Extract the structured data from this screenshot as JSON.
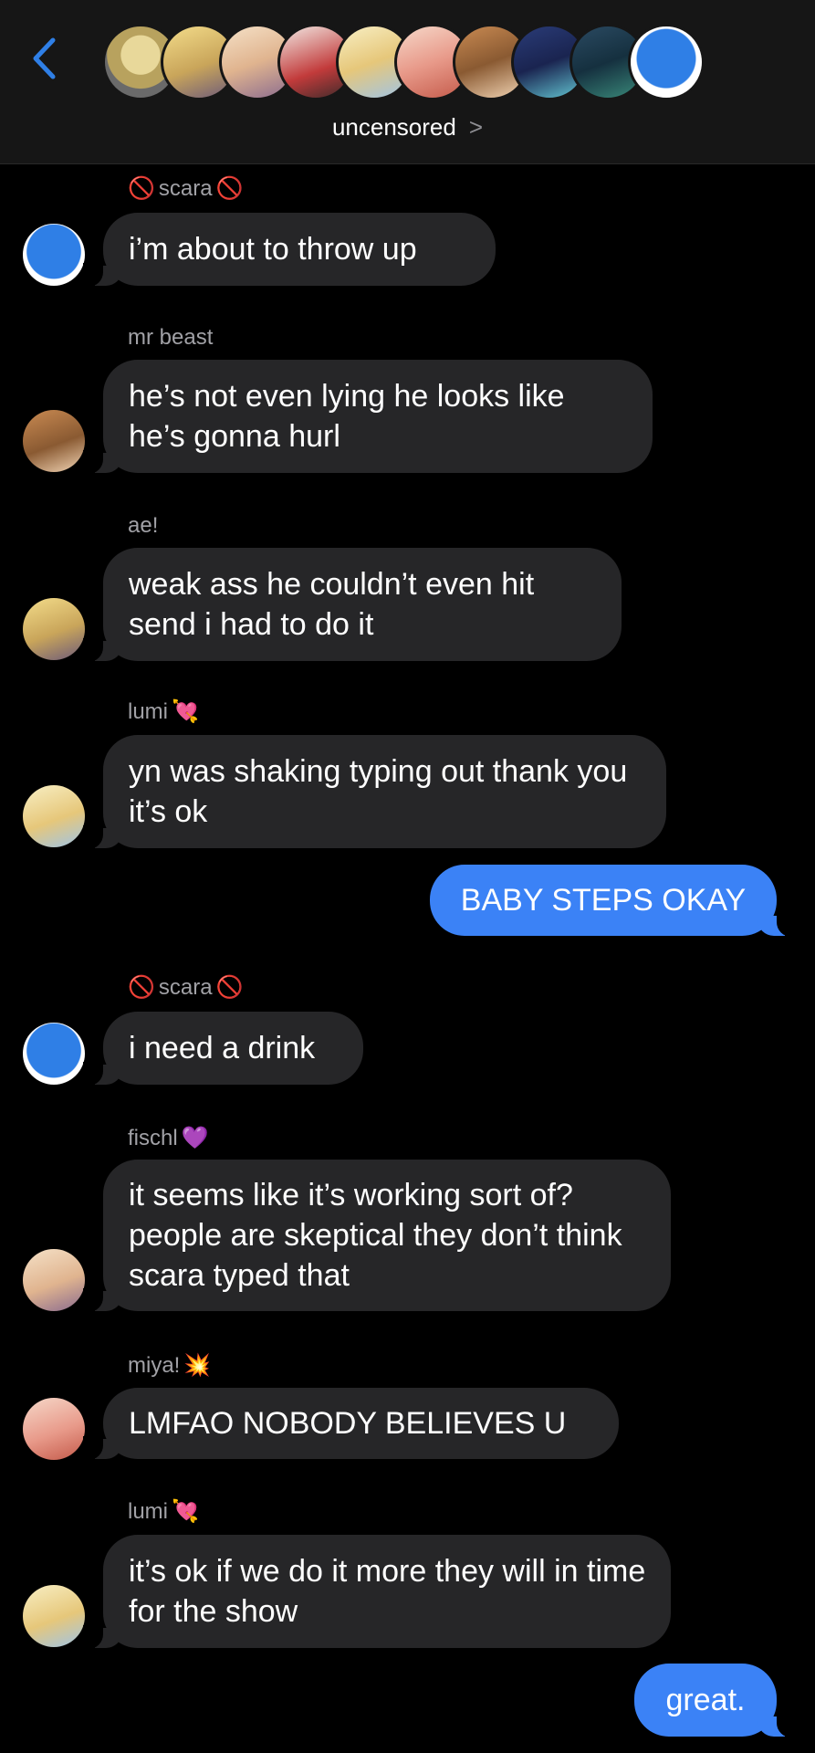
{
  "header": {
    "title": "uncensored",
    "chevron": ">",
    "back_icon": "chevron-left-icon",
    "accent": "#2f7fe6",
    "group_avatars": 11
  },
  "messages": [
    {
      "sender": "scara",
      "sender_prefix_icon": "prohibited-icon",
      "sender_suffix_icon": "prohibited-icon",
      "text": "i’m about to throw up",
      "side": "left"
    },
    {
      "sender": "mr beast",
      "text": "he’s not even lying he looks like he’s gonna hurl",
      "side": "left"
    },
    {
      "sender": "ae!",
      "text": "weak ass he couldn’t even hit send i had to do it",
      "side": "left"
    },
    {
      "sender": "lumi",
      "sender_suffix_icon": "heart-with-arrow-icon",
      "text": "yn was shaking typing out thank you it’s ok",
      "side": "left"
    },
    {
      "text": "BABY STEPS OKAY",
      "side": "right"
    },
    {
      "sender": "scara",
      "sender_prefix_icon": "prohibited-icon",
      "sender_suffix_icon": "prohibited-icon",
      "text": "i need a drink",
      "side": "left"
    },
    {
      "sender": "fischl",
      "sender_suffix_icon": "purple-heart-icon",
      "text": "it seems like it’s working sort of? people are skeptical they don’t think scara typed that",
      "side": "left"
    },
    {
      "sender": "miya!",
      "sender_suffix_icon": "collision-icon",
      "text": "LMFAO NOBODY BELIEVES U",
      "side": "left"
    },
    {
      "sender": "lumi",
      "sender_suffix_icon": "heart-with-arrow-icon",
      "text": "it’s ok if we do it more they will in time for the show",
      "side": "left"
    },
    {
      "text": "great.",
      "side": "right"
    }
  ],
  "colors": {
    "background": "#000000",
    "incoming_bubble": "#262628",
    "outgoing_bubble": "#3b82f6",
    "sender_name": "#a1a1a6"
  }
}
